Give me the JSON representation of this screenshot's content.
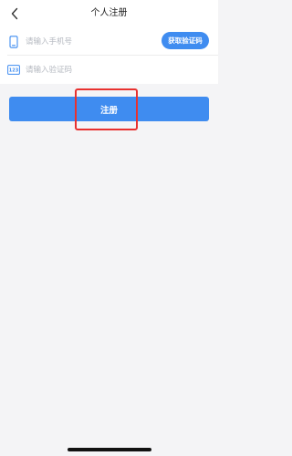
{
  "nav": {
    "title": "个人注册"
  },
  "form": {
    "phone": {
      "placeholder": "请输入手机号",
      "value": ""
    },
    "get_code_label": "获取验证码",
    "code": {
      "placeholder": "请输入验证码",
      "value": "",
      "icon_text": "123"
    }
  },
  "register_label": "注册",
  "colors": {
    "accent": "#3f8cf0",
    "highlight": "#e8312f",
    "background": "#f4f4f6"
  },
  "icons": {
    "back": "chevron-left-icon",
    "phone": "phone-icon",
    "code": "verification-code-icon"
  }
}
